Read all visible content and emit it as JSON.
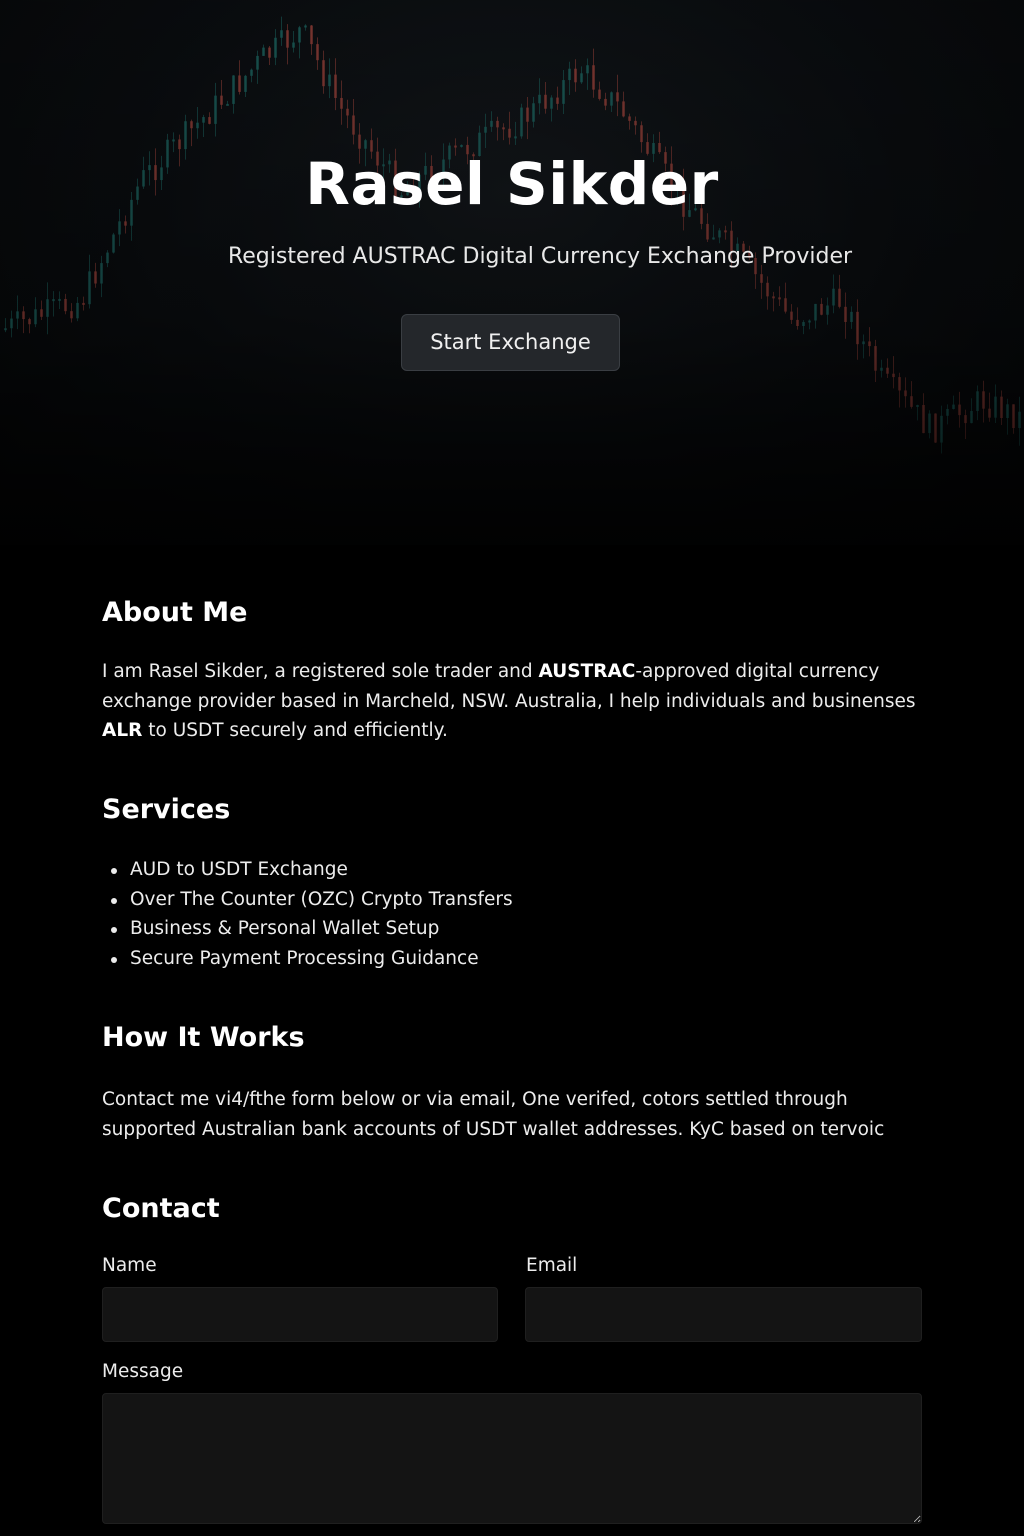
{
  "hero": {
    "title": "Rasel Sikder",
    "subtitle": "Registered AUSTRAC Digital Currency Exchange Provider",
    "cta_label": "Start Exchange"
  },
  "about": {
    "heading": "About Me",
    "text_part1": "I am Rasel Sikder, a registered sole trader and ",
    "text_bold": "AUSTRAC",
    "text_part2": "-approved digital currency exchange provider based in Marcheld, NSW. Australia, I help individuals and businenses ",
    "text_bold2": "ALR",
    "text_part3": " to USDT securely and efficiently."
  },
  "services": {
    "heading": "Services",
    "items": [
      "AUD to USDT Exchange",
      "Over The Counter (OZC) Crypto Transfers",
      "Business & Personal Wallet Setup",
      "Secure Payment Processing Guidance"
    ]
  },
  "how_it_works": {
    "heading": "How It Works",
    "text": "Contact me vi4/fthe form below or via email, One verifed, cotors settled through supported Australian bank accounts of USDT wallet addresses. KyC based on tervoic"
  },
  "contact": {
    "heading": "Contact",
    "name_label": "Name",
    "name_value": "",
    "email_label": "Email",
    "email_value": "",
    "message_label": "Message",
    "message_value": ""
  },
  "colors": {
    "background": "#000000",
    "button_bg": "#24272b",
    "input_bg": "#141414",
    "chart_up": "#1f6f6a",
    "chart_down": "#a8483f"
  }
}
